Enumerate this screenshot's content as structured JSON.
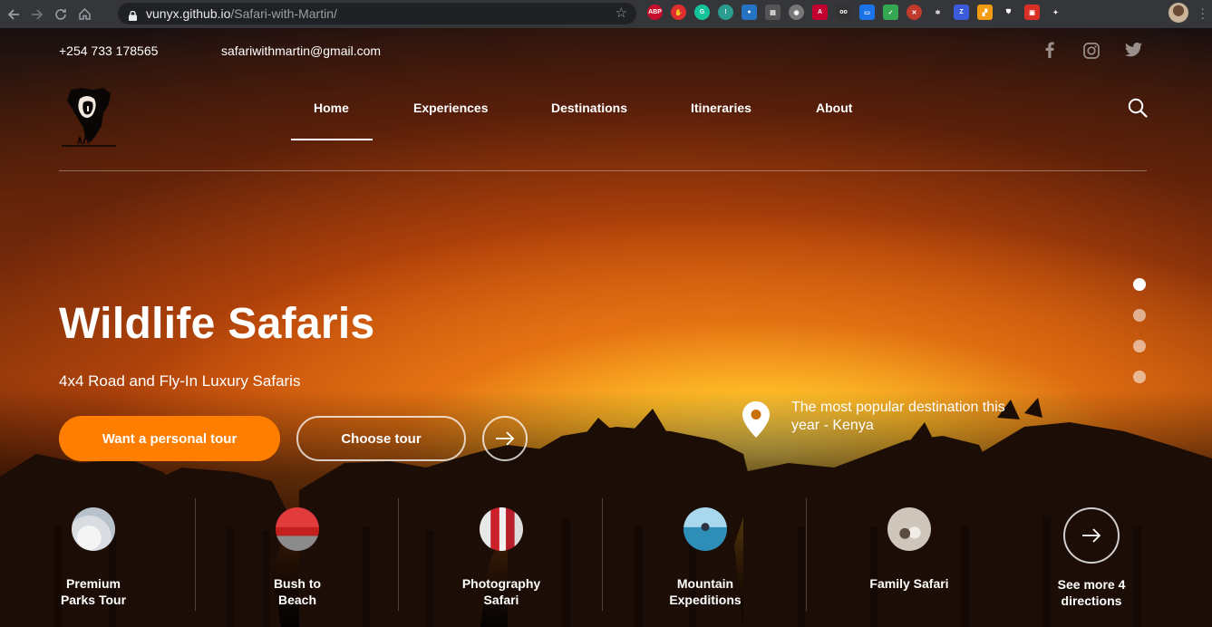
{
  "browser": {
    "url_host": "vunyx.github.io",
    "url_path": "/Safari-with-Martin/",
    "extensions": [
      {
        "name": "adblock-icon",
        "text": "ABP",
        "color": "#c70d2c",
        "round": true
      },
      {
        "name": "stop-hand-icon",
        "text": "✋",
        "color": "#e02e2e",
        "round": true
      },
      {
        "name": "grammarly-icon",
        "text": "G",
        "color": "#15c39a",
        "round": true
      },
      {
        "name": "counter-extension-icon",
        "text": "!",
        "color": "#2a9d8f",
        "round": true
      },
      {
        "name": "counter-extension-2-icon",
        "text": "●",
        "color": "#2573c2",
        "round": false
      },
      {
        "name": "reader-icon",
        "text": "▤",
        "color": "#555555",
        "round": false
      },
      {
        "name": "record-icon",
        "text": "◉",
        "color": "#777777",
        "round": true
      },
      {
        "name": "angular-icon",
        "text": "A",
        "color": "#c3002f",
        "round": false
      },
      {
        "name": "glasses-icon",
        "text": "oo",
        "color": "#333333",
        "round": false
      },
      {
        "name": "window-extension-icon",
        "text": "▭",
        "color": "#1a73e8",
        "round": false
      },
      {
        "name": "shield-check-icon",
        "text": "✓",
        "color": "#34a853",
        "round": false
      },
      {
        "name": "close-extension-icon",
        "text": "✕",
        "color": "#c0392b",
        "round": true
      },
      {
        "name": "react-icon",
        "text": "⚛",
        "color": "#35363a",
        "round": true
      },
      {
        "name": "z-extension-icon",
        "text": "Z",
        "color": "#3b5bdb",
        "round": false
      },
      {
        "name": "flag-extension-icon",
        "text": "▞",
        "color": "#f39c12",
        "round": false
      },
      {
        "name": "privacy-shield-icon",
        "text": "⛊",
        "color": "#35363a",
        "round": false
      },
      {
        "name": "calendar-extension-icon",
        "text": "▣",
        "color": "#d93025",
        "round": false
      },
      {
        "name": "puzzle-icon",
        "text": "✦",
        "color": "#35363a",
        "round": false
      }
    ]
  },
  "topbar": {
    "phone": "+254 733 178565",
    "email": "safariwithmartin@gmail.com",
    "social": [
      "facebook-icon",
      "instagram-icon",
      "twitter-icon"
    ]
  },
  "nav": {
    "items": [
      "Home",
      "Experiences",
      "Destinations",
      "Itineraries",
      "About"
    ],
    "active": "Home"
  },
  "hero": {
    "title": "Wildlife Safaris",
    "subtitle": "4x4 Road and Fly-In Luxury Safaris",
    "primary_button": "Want a personal tour",
    "secondary_button": "Choose tour",
    "popular_text": "The most popular destination this year - Kenya",
    "slides_total": 4,
    "slide_active": 1
  },
  "categories": [
    {
      "label_line1": "Premium",
      "label_line2": "Parks Tour"
    },
    {
      "label_line1": "Bush to",
      "label_line2": "Beach"
    },
    {
      "label_line1": "Photography",
      "label_line2": "Safari"
    },
    {
      "label_line1": "Mountain",
      "label_line2": "Expeditions"
    },
    {
      "label_line1": "Family Safari",
      "label_line2": ""
    }
  ],
  "more": {
    "label_line1": "See more 4",
    "label_line2": "directions"
  },
  "colors": {
    "accent": "#ff7e00",
    "chrome_bg": "#35363a",
    "omnibox_bg": "#202124"
  }
}
